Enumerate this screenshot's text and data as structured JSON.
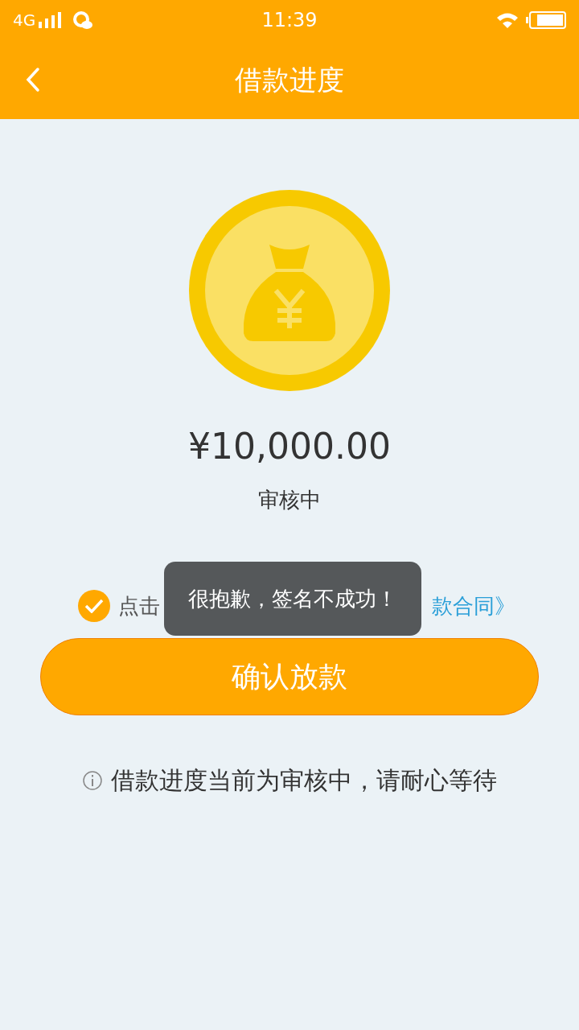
{
  "status_bar": {
    "network": "4G",
    "time": "11:39"
  },
  "header": {
    "title": "借款进度"
  },
  "amount": "¥10,000.00",
  "status": "审核中",
  "agreement": {
    "checked": true,
    "text": "点击",
    "link": "款合同》"
  },
  "confirm_button": "确认放款",
  "notice": "借款进度当前为审核中，请耐心等待",
  "toast": "很抱歉，签名不成功！"
}
